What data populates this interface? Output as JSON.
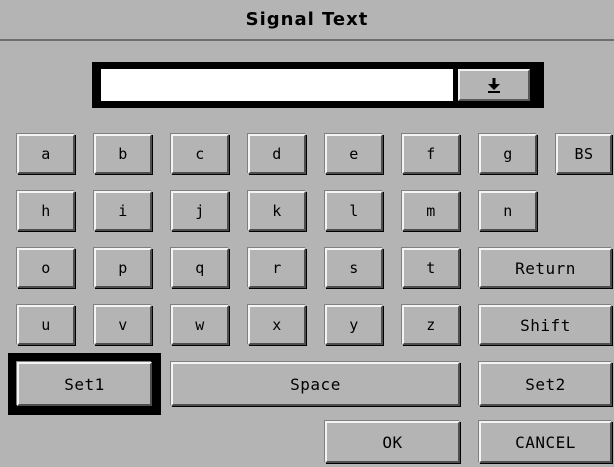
{
  "window": {
    "title": "Signal Text"
  },
  "entry": {
    "value": "",
    "dropdown_icon": "down-arrow-icon"
  },
  "keys": {
    "row1": [
      "a",
      "b",
      "c",
      "d",
      "e",
      "f",
      "g",
      "BS"
    ],
    "row2": [
      "h",
      "i",
      "j",
      "k",
      "l",
      "m",
      "n"
    ],
    "row3": [
      "o",
      "p",
      "q",
      "r",
      "s",
      "t",
      "Return"
    ],
    "row4": [
      "u",
      "v",
      "w",
      "x",
      "y",
      "z",
      "Shift"
    ],
    "set1": "Set1",
    "space": "Space",
    "set2": "Set2"
  },
  "actions": {
    "ok": "OK",
    "cancel": "CANCEL"
  },
  "colors": {
    "background": "#b4b4b4",
    "focus_frame": "#000000",
    "field": "#ffffff"
  }
}
